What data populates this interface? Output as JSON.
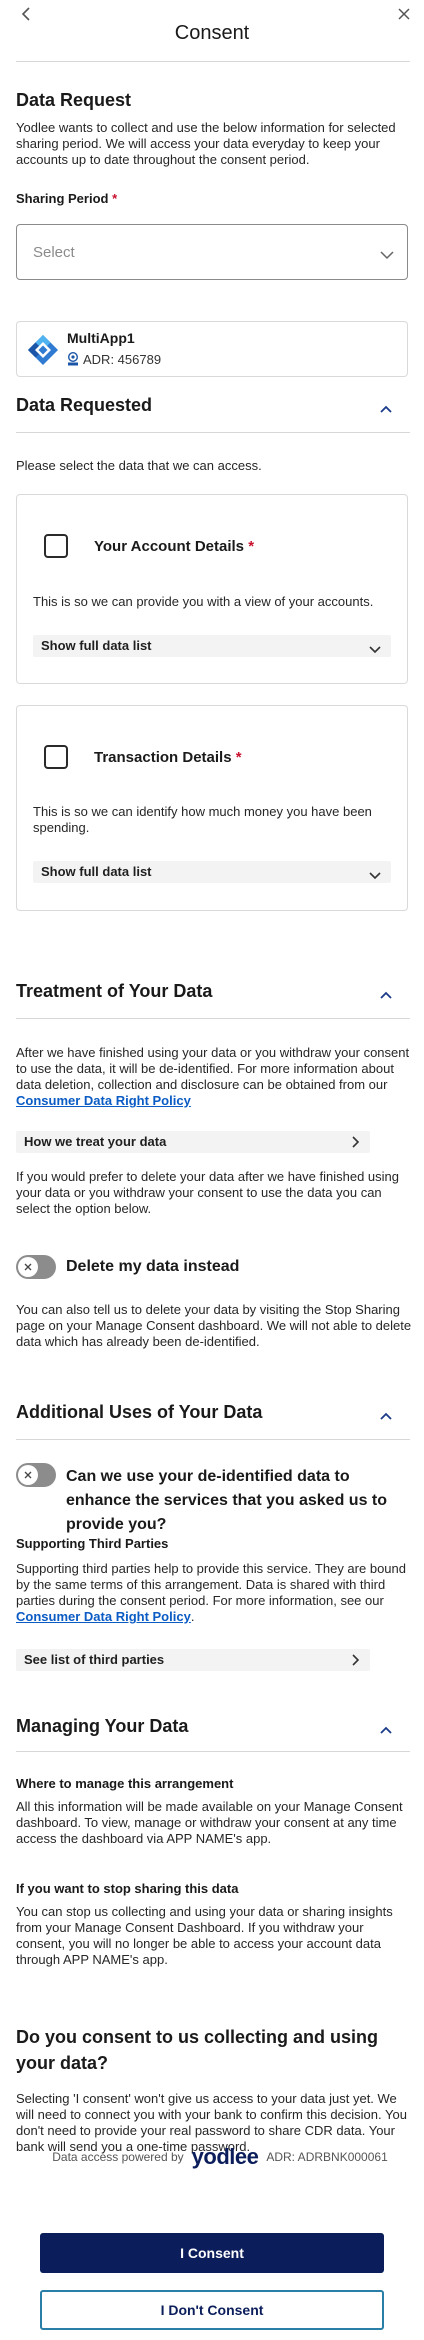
{
  "header": {
    "title": "Consent"
  },
  "data_request": {
    "heading": "Data Request",
    "intro": "Yodlee wants to collect and use the below information for selected sharing period. We will access your data everyday to keep your accounts up to date throughout the consent period.",
    "sharing_period_label": "Sharing Period",
    "required_mark": "*",
    "select_placeholder": "Select"
  },
  "app": {
    "name": "MultiApp1",
    "adr": "ADR: 456789",
    "badge": "CDR"
  },
  "data_requested": {
    "heading": "Data Requested",
    "intro": "Please select the data that we can access.",
    "items": [
      {
        "title": "Your Account Details",
        "desc": "This is so we can provide you with a view of your accounts.",
        "link": "Show full data list"
      },
      {
        "title": "Transaction Details",
        "desc": "This is so we can identify how much money you have been spending.",
        "link": "Show full data list"
      }
    ]
  },
  "treatment": {
    "heading": "Treatment of Your Data",
    "para1": "After we have finished using your data or you withdraw your consent to use the data, it will be de-identified. For more information about data deletion, collection and disclosure can be obtained from our",
    "policy_link": "Consumer Data Right Policy",
    "how_link": "How we treat your data",
    "para2": "If you would prefer to delete your data after we have finished using your data or you withdraw your consent to use the data you can select the option below.",
    "toggle_label": "Delete my data instead",
    "para3": "You can also tell us to delete your data by visiting the Stop Sharing page on your Manage Consent dashboard. We will not able to delete data which has already been de-identified."
  },
  "additional": {
    "heading": "Additional Uses of Your Data",
    "toggle_label": "Can we use your de-identified data to enhance the services that you asked us to provide you?",
    "third_heading": "Supporting Third Parties",
    "third_para": "Supporting third parties help to provide this service. They are bound by the same terms of this arrangement. Data is shared with third parties during the consent period. For more information, see our",
    "policy_link": "Consumer Data Right Policy",
    "period": ".",
    "list_link": "See list of third parties"
  },
  "managing": {
    "heading": "Managing Your Data",
    "where_heading": "Where to manage this arrangement",
    "where_para": "All this information will be made available on your Manage Consent dashboard. To view, manage or withdraw your consent at any time access the dashboard via APP NAME's app.",
    "stop_heading": "If you want to stop sharing this data",
    "stop_para": "You can stop us collecting and using your data or sharing insights from your Manage Consent Dashboard. If you withdraw your consent, you will no longer be able to access your account data through APP NAME's app."
  },
  "consent": {
    "question": "Do you consent to us collecting and using your data?",
    "para": "Selecting 'I consent' won't give us access to your data just yet. We will need to connect you with your bank to confirm this decision. You don't need to provide your real password to share CDR data. Your bank will send you a one-time password.",
    "powered_by": "Data access powered by",
    "brand": "yodlee",
    "adr": "ADR: ADRBNK000061",
    "accept": "I Consent",
    "decline": "I Don't Consent"
  }
}
